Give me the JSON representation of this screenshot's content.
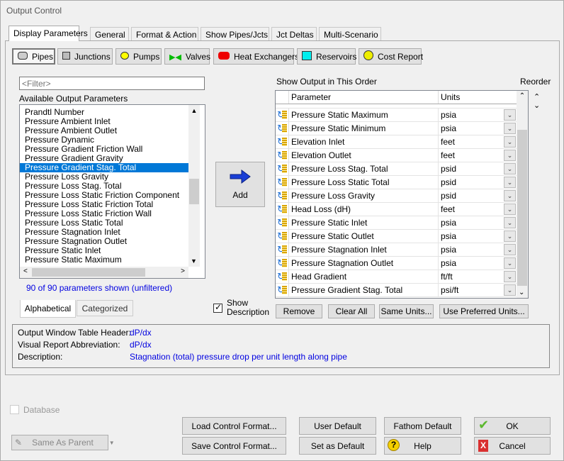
{
  "window": {
    "title": "Output Control"
  },
  "tabs": [
    "Display Parameters",
    "General",
    "Format & Action",
    "Show Pipes/Jcts",
    "Jct Deltas",
    "Multi-Scenario"
  ],
  "type_buttons": [
    {
      "label": "Pipes",
      "icon": "pipe-icon"
    },
    {
      "label": "Junctions",
      "icon": "junction-icon"
    },
    {
      "label": "Pumps",
      "icon": "pump-icon"
    },
    {
      "label": "Valves",
      "icon": "valve-icon"
    },
    {
      "label": "Heat Exchangers",
      "icon": "heat-exchanger-icon"
    },
    {
      "label": "Reservoirs",
      "icon": "reservoir-icon"
    },
    {
      "label": "Cost Report",
      "icon": "cost-report-icon"
    }
  ],
  "filter": {
    "placeholder": "<Filter>"
  },
  "available": {
    "label": "Available Output Parameters",
    "selected": "Pressure Gradient Stag. Total",
    "items": [
      "Prandtl Number",
      "Pressure Ambient Inlet",
      "Pressure Ambient Outlet",
      "Pressure Dynamic",
      "Pressure Gradient Friction Wall",
      "Pressure Gradient Gravity",
      "Pressure Gradient Stag. Total",
      "Pressure Loss Gravity",
      "Pressure Loss Stag. Total",
      "Pressure Loss Static Friction Component",
      "Pressure Loss Static Friction Total",
      "Pressure Loss Static Friction Wall",
      "Pressure Loss Static Total",
      "Pressure Stagnation Inlet",
      "Pressure Stagnation Outlet",
      "Pressure Static Inlet",
      "Pressure Static Maximum"
    ],
    "count_text": "90 of 90 parameters shown (unfiltered)"
  },
  "list_tabs": [
    "Alphabetical",
    "Categorized"
  ],
  "add_label": "Add",
  "show_description": {
    "label": "Show Description",
    "checked": true
  },
  "output": {
    "label": "Show Output in This Order",
    "reorder_label": "Reorder",
    "headers": [
      "Parameter",
      "Units"
    ],
    "rows": [
      [
        "Pressure Static Maximum",
        "psia"
      ],
      [
        "Pressure Static Minimum",
        "psia"
      ],
      [
        "Elevation Inlet",
        "feet"
      ],
      [
        "Elevation Outlet",
        "feet"
      ],
      [
        "Pressure Loss Stag. Total",
        "psid"
      ],
      [
        "Pressure Loss Static Total",
        "psid"
      ],
      [
        "Pressure Loss Gravity",
        "psid"
      ],
      [
        "Head Loss (dH)",
        "feet"
      ],
      [
        "Pressure Static Inlet",
        "psia"
      ],
      [
        "Pressure Static Outlet",
        "psia"
      ],
      [
        "Pressure Stagnation Inlet",
        "psia"
      ],
      [
        "Pressure Stagnation Outlet",
        "psia"
      ],
      [
        "Head Gradient",
        "ft/ft"
      ],
      [
        "Pressure Gradient Stag. Total",
        "psi/ft"
      ]
    ]
  },
  "grid_buttons": [
    "Remove",
    "Clear All",
    "Same Units...",
    "Use Preferred Units..."
  ],
  "description": {
    "header_label": "Output Window Table Header:",
    "header_value": "dP/dx",
    "abbr_label": "Visual Report Abbreviation:",
    "abbr_value": "dP/dx",
    "desc_label": "Description:",
    "desc_value": "Stagnation (total) pressure drop per unit length along pipe"
  },
  "bottom": {
    "database": "Database",
    "same_as_parent": "Same As Parent",
    "load": "Load Control Format...",
    "save": "Save Control Format...",
    "user_default": "User Default",
    "set_default": "Set as Default",
    "fathom_default": "Fathom Default",
    "help": "Help",
    "ok": "OK",
    "cancel": "Cancel"
  },
  "colors": {
    "selection": "#0078d7",
    "link_blue": "#0000e0"
  }
}
